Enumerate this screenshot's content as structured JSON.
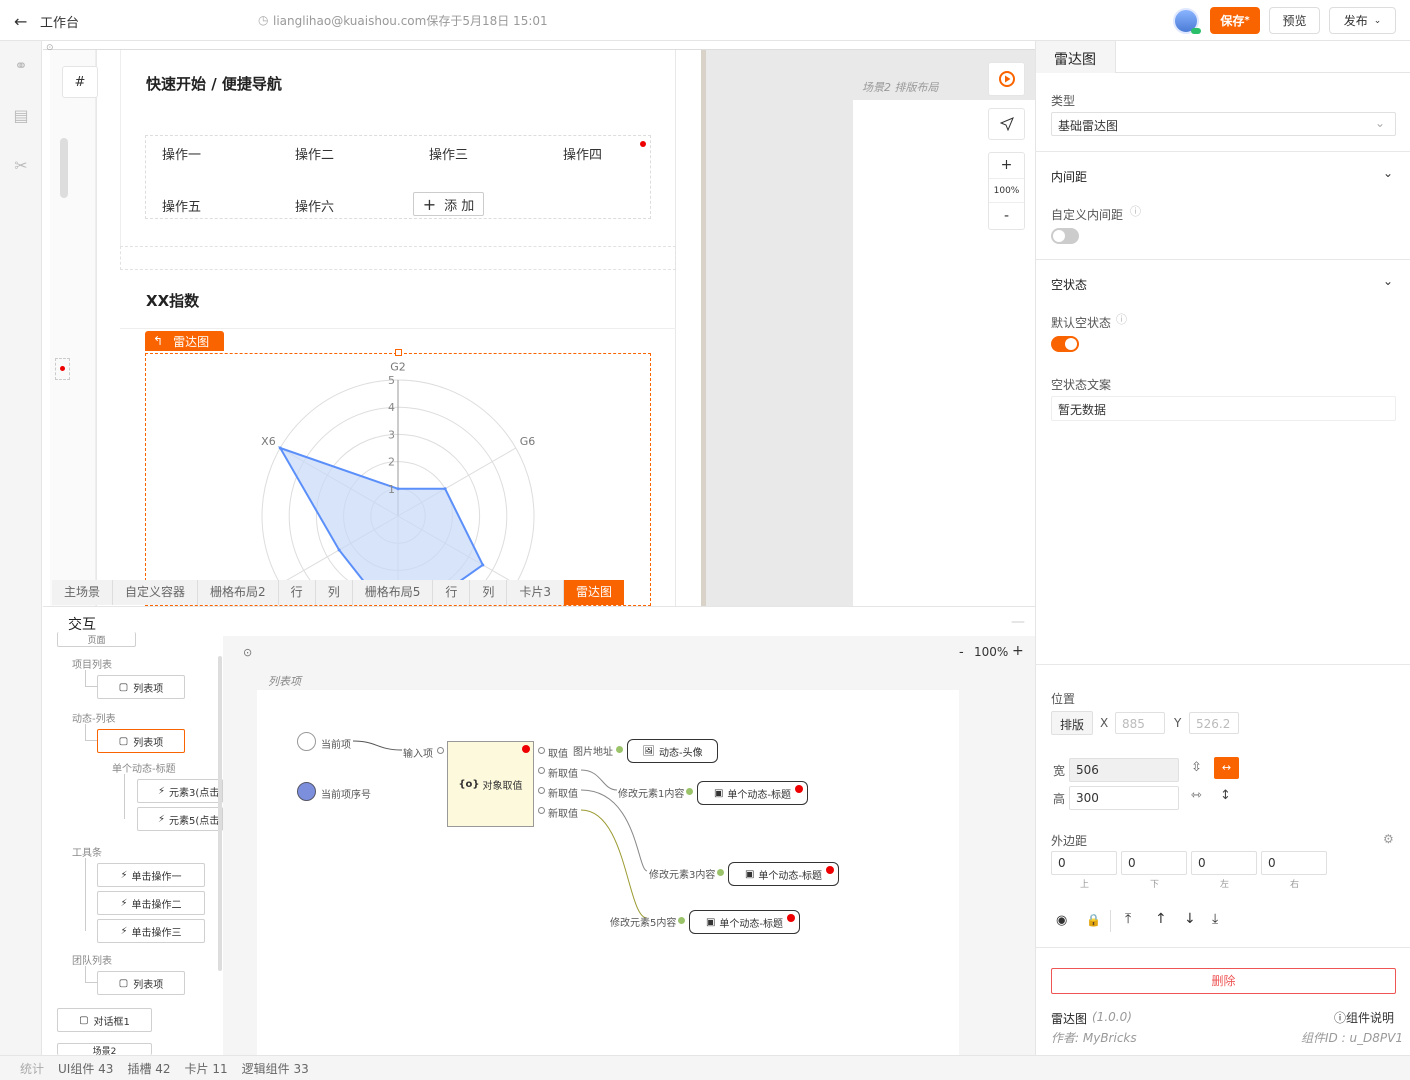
{
  "header": {
    "back_label": "工作台",
    "save_info": "lianglihao@kuaishou.com保存于5月18日 15:01",
    "save_label": "保存",
    "save_mark": "*",
    "preview_label": "预览",
    "publish_label": "发布"
  },
  "canvas": {
    "scene2_label": "场景2  排版布局",
    "hash_label": "#",
    "quickstart_title": "快速开始 / 便捷导航",
    "ops": [
      "操作一",
      "操作二",
      "操作三",
      "操作四",
      "操作五",
      "操作六"
    ],
    "add_label": "添 加",
    "index_title": "XX指数",
    "radar_tag": "雷达图",
    "zoom_label": "100%",
    "zoom_in": "+",
    "zoom_out": "-",
    "breadcrumbs": [
      "主场景",
      "自定义容器",
      "栅格布局2",
      "行",
      "列",
      "栅格布局5",
      "行",
      "列",
      "卡片3",
      "雷达图"
    ]
  },
  "chart_data": {
    "type": "radar",
    "axes": [
      "G2",
      "G6",
      "",
      "",
      "",
      "X6"
    ],
    "rlim": [
      0,
      5
    ],
    "ticks": [
      1,
      2,
      3,
      4,
      5
    ],
    "series": [
      {
        "values": [
          1,
          2,
          3.6,
          4,
          2.5,
          5
        ]
      }
    ],
    "fill_color": "#c8d8f8",
    "line_color": "#5b8ff9"
  },
  "props": {
    "tab_label": "雷达图",
    "type_label": "类型",
    "type_value": "基础雷达图",
    "padding_section": "内间距",
    "custom_padding_label": "自定义内间距",
    "custom_padding_on": false,
    "empty_section": "空状态",
    "default_empty_label": "默认空状态",
    "default_empty_on": true,
    "empty_text_label": "空状态文案",
    "empty_text_value": "暂无数据",
    "position_label": "位置",
    "layout_btn": "排版",
    "x_label": "X",
    "x_value": "885",
    "y_label": "Y",
    "y_value": "526.2",
    "width_label": "宽",
    "width_value": "506",
    "height_label": "高",
    "height_value": "300",
    "margin_label": "外边距",
    "margins": [
      {
        "value": "0",
        "side": "上"
      },
      {
        "value": "0",
        "side": "下"
      },
      {
        "value": "0",
        "side": "左"
      },
      {
        "value": "0",
        "side": "右"
      }
    ],
    "delete_label": "删除",
    "comp_name": "雷达图",
    "comp_version": "(1.0.0)",
    "doc_label": "组件说明",
    "author": "作者: MyBricks",
    "comp_id": "组件ID : u_D8PV1"
  },
  "interaction": {
    "title": "交互",
    "graph_zoom": "100%",
    "graph_title": "列表项",
    "tree": {
      "partial_top": "页面",
      "group1": "项目列表",
      "group1_item": "列表项",
      "group2": "动态-列表",
      "group2_item": "列表项",
      "group2_sub": "单个动态-标题",
      "sub_items": [
        "元素3(点击",
        "元素5(点击"
      ],
      "group3": "工具条",
      "toolbar_items": [
        "单击操作一",
        "单击操作二",
        "单击操作三"
      ],
      "group4": "团队列表",
      "group4_item": "列表项",
      "dialog": "对话框1",
      "partial_bottom": "场景2"
    },
    "graph": {
      "in_current": "当前项",
      "in_index": "当前项序号",
      "input_port": "输入项",
      "node_title": "对象取值",
      "out_ports": [
        "取值",
        "新取值",
        "新取值",
        "新取值"
      ],
      "link_labels": [
        "图片地址",
        "修改元素1内容",
        "修改元素3内容",
        "修改元素5内容"
      ],
      "targets": [
        "动态-头像",
        "单个动态-标题",
        "单个动态-标题",
        "单个动态-标题"
      ]
    }
  },
  "status": {
    "items": [
      "统计",
      "UI组件 43",
      "插槽 42",
      "卡片 11",
      "逻辑组件 33"
    ]
  }
}
